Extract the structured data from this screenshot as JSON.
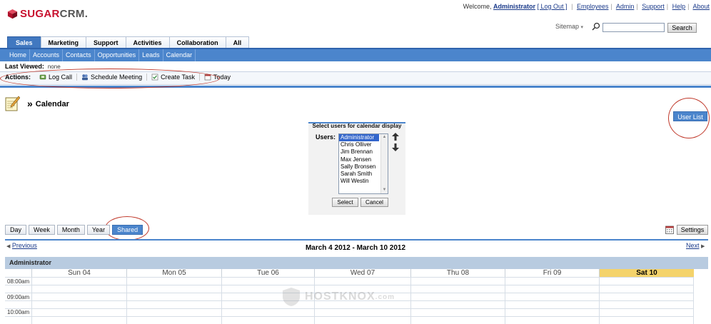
{
  "brand": {
    "name_part1": "SUGAR",
    "name_part2": "CRM",
    "registered": "."
  },
  "topbar": {
    "welcome": "Welcome,",
    "user": "Administrator",
    "logout": "[ Log Out ]",
    "links": [
      "Employees",
      "Admin",
      "Support",
      "Help",
      "About"
    ]
  },
  "sitemap": {
    "label": "Sitemap",
    "arrow": "▾"
  },
  "search": {
    "placeholder": "",
    "button": "Search"
  },
  "module_tabs": [
    "Sales",
    "Marketing",
    "Support",
    "Activities",
    "Collaboration",
    "All"
  ],
  "sub_nav": [
    "Home",
    "Accounts",
    "Contacts",
    "Opportunities",
    "Leads",
    "Calendar"
  ],
  "last_viewed": {
    "label": "Last Viewed:",
    "value": "none"
  },
  "actions": {
    "label": "Actions:",
    "items": [
      "Log Call",
      "Schedule Meeting",
      "Create Task",
      "Today"
    ]
  },
  "page": {
    "chevron": "»",
    "title": "Calendar"
  },
  "user_list_button": "User List",
  "select_users": {
    "title": "Select users for calendar display",
    "label": "Users:",
    "options": [
      "Administrator",
      "Chris Olliver",
      "Jim Brennan",
      "Max Jensen",
      "Sally Bronsen",
      "Sarah Smith",
      "Will Westin"
    ],
    "selected": "Administrator",
    "select_button": "Select",
    "cancel_button": "Cancel"
  },
  "view_tabs": [
    "Day",
    "Week",
    "Month",
    "Year",
    "Shared"
  ],
  "active_view": "Shared",
  "settings_button": "Settings",
  "nav": {
    "previous": "Previous",
    "next": "Next"
  },
  "range": "March 4 2012 - March 10 2012",
  "owner": "Administrator",
  "days": [
    "Sun 04",
    "Mon 05",
    "Tue 06",
    "Wed 07",
    "Thu 08",
    "Fri 09",
    "Sat 10"
  ],
  "today_day": "Sat 10",
  "times": [
    "08:00am",
    "09:00am",
    "10:00am"
  ],
  "watermark": "HOSTKNOX",
  "watermark_suffix": ".com",
  "colors": {
    "accent": "#4b85cc",
    "tab_active": "#4178c0",
    "today": "#f4d36b",
    "annotation": "#c0392b"
  }
}
